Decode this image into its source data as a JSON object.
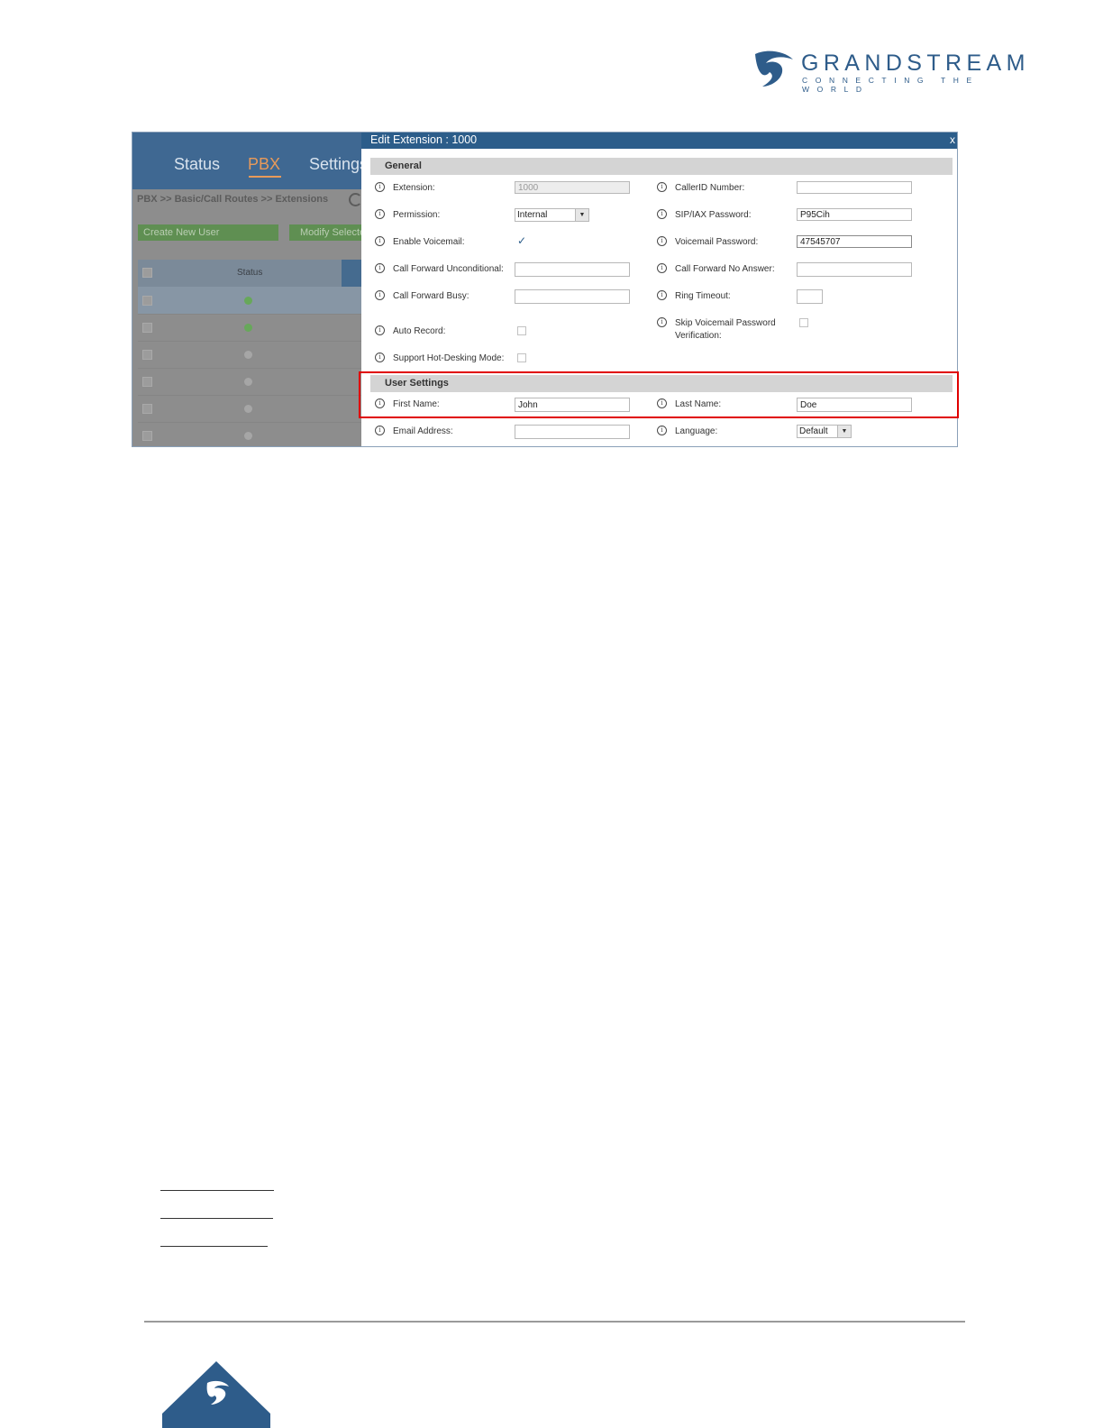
{
  "header": {
    "brand": "GRANDSTREAM",
    "tagline": "CONNECTING THE WORLD",
    "brand_color": "#2e5c8a"
  },
  "background_app": {
    "nav": [
      "Status",
      "PBX",
      "Settings"
    ],
    "active_nav": "PBX",
    "breadcrumb": "PBX >> Basic/Call Routes >> Extensions",
    "buttons": {
      "create_user": "Create New User",
      "modify_selected": "Modify Selected"
    },
    "table": {
      "status_header": "Status",
      "rows": [
        {
          "status": "online",
          "selected": true
        },
        {
          "status": "online",
          "selected": false
        },
        {
          "status": "offline",
          "selected": false
        },
        {
          "status": "offline",
          "selected": false
        },
        {
          "status": "offline",
          "selected": false
        },
        {
          "status": "offline",
          "selected": false
        }
      ]
    }
  },
  "dialog": {
    "title": "Edit Extension : 1000",
    "close": "x",
    "general": {
      "heading": "General",
      "extension": {
        "label": "Extension:",
        "value": "1000"
      },
      "callerid": {
        "label": "CallerID Number:",
        "value": ""
      },
      "permission": {
        "label": "Permission:",
        "value": "Internal"
      },
      "sip_password": {
        "label": "SIP/IAX Password:",
        "value": "P95Cih"
      },
      "enable_voicemail": {
        "label": "Enable Voicemail:",
        "checked": true
      },
      "voicemail_password": {
        "label": "Voicemail Password:",
        "value": "47545707"
      },
      "cf_unconditional": {
        "label": "Call Forward Unconditional:",
        "value": ""
      },
      "cf_no_answer": {
        "label": "Call Forward No Answer:",
        "value": ""
      },
      "cf_busy": {
        "label": "Call Forward Busy:",
        "value": ""
      },
      "ring_timeout": {
        "label": "Ring Timeout:",
        "value": ""
      },
      "auto_record": {
        "label": "Auto Record:",
        "checked": false
      },
      "skip_vm_pw_line1": "Skip Voicemail Password",
      "skip_vm_pw_line2": "Verification:",
      "skip_vm_pw_checked": false,
      "hot_desking": {
        "label": "Support Hot-Desking Mode:",
        "checked": false
      }
    },
    "user_settings": {
      "heading": "User Settings",
      "first_name": {
        "label": "First Name:",
        "value": "John"
      },
      "last_name": {
        "label": "Last Name:",
        "value": "Doe"
      },
      "email": {
        "label": "Email Address:",
        "value": ""
      },
      "language": {
        "label": "Language:",
        "value": "Default"
      }
    }
  },
  "highlight_color": "#e00000"
}
